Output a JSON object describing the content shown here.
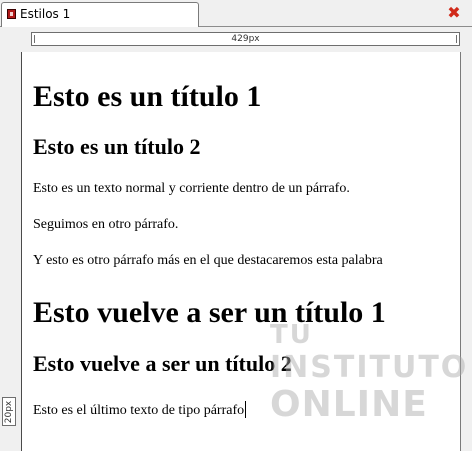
{
  "tab": {
    "title": "Estilos 1",
    "icon": "html-file-icon",
    "close_icon": "close-icon",
    "close_symbol": "✖",
    "close_color": "#d12a1a"
  },
  "rulers": {
    "width_label": "429px",
    "height_label": "20px"
  },
  "document": {
    "heading1_a": "Esto es un título 1",
    "heading2_a": "Esto es un título 2",
    "para1": "Esto es un texto normal y corriente dentro de un párrafo.",
    "para2": "Seguimos en otro párrafo.",
    "para3": "Y esto es otro párrafo más en el que destacaremos esta palabra",
    "heading1_b": "Esto vuelve a ser un título 1",
    "heading2_b": "Esto vuelve a ser un título 2",
    "para4": "Esto es el último texto de tipo párrafo"
  },
  "watermark": {
    "line1": "TU",
    "line2": "INSTITUTO",
    "line3": "ONLINE"
  }
}
